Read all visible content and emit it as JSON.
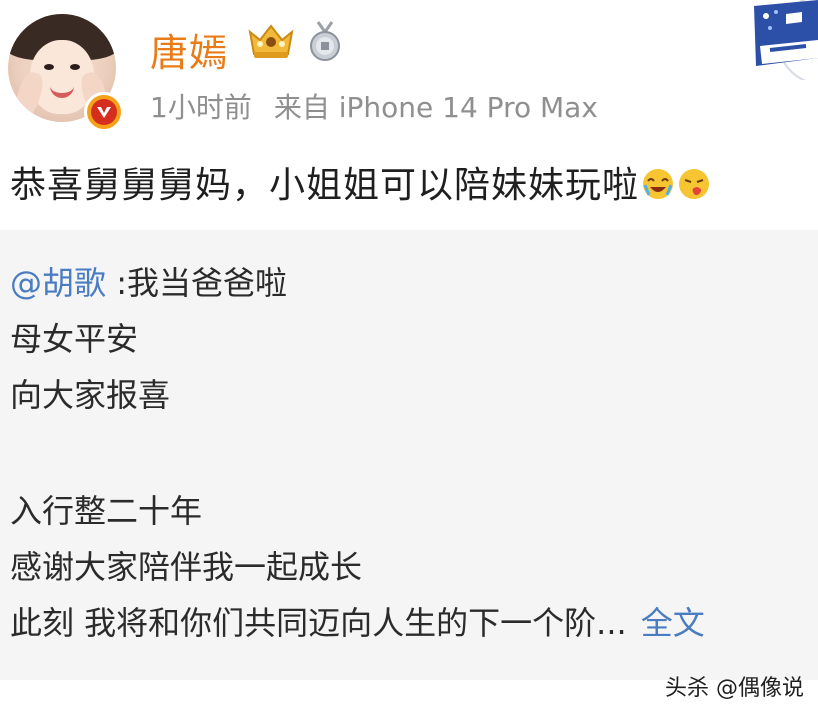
{
  "user": {
    "name": "唐嫣",
    "time": "1小时前",
    "source": "来自 iPhone 14 Pro Max"
  },
  "post": {
    "text": "恭喜舅舅舅妈，小姐姐可以陪妹妹玩啦",
    "emojis": [
      "cry-happy-emoji",
      "kiss-emoji"
    ]
  },
  "repost": {
    "mention": "@胡歌",
    "line1_rest": " :我当爸爸啦",
    "line2": "母女平安",
    "line3": "向大家报喜",
    "line4": "入行整二十年",
    "line5": "感谢大家陪伴我一起成长",
    "line6": "此刻 我将和你们共同迈向人生的下一个阶...",
    "full_text_link": "全文"
  },
  "watermark": "头杀 @偶像说",
  "colors": {
    "username": "#e97b18",
    "link": "#4a7cc2",
    "meta": "#8f8f8f",
    "repost_bg": "#f5f5f5"
  }
}
